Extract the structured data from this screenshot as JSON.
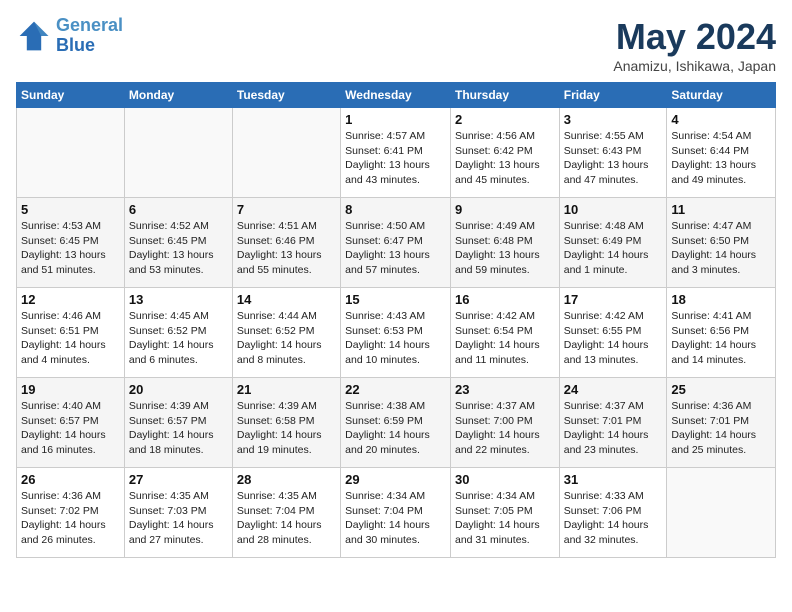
{
  "header": {
    "logo_line1": "General",
    "logo_line2": "Blue",
    "month_title": "May 2024",
    "subtitle": "Anamizu, Ishikawa, Japan"
  },
  "weekdays": [
    "Sunday",
    "Monday",
    "Tuesday",
    "Wednesday",
    "Thursday",
    "Friday",
    "Saturday"
  ],
  "weeks": [
    [
      {
        "day": "",
        "info": ""
      },
      {
        "day": "",
        "info": ""
      },
      {
        "day": "",
        "info": ""
      },
      {
        "day": "1",
        "info": "Sunrise: 4:57 AM\nSunset: 6:41 PM\nDaylight: 13 hours\nand 43 minutes."
      },
      {
        "day": "2",
        "info": "Sunrise: 4:56 AM\nSunset: 6:42 PM\nDaylight: 13 hours\nand 45 minutes."
      },
      {
        "day": "3",
        "info": "Sunrise: 4:55 AM\nSunset: 6:43 PM\nDaylight: 13 hours\nand 47 minutes."
      },
      {
        "day": "4",
        "info": "Sunrise: 4:54 AM\nSunset: 6:44 PM\nDaylight: 13 hours\nand 49 minutes."
      }
    ],
    [
      {
        "day": "5",
        "info": "Sunrise: 4:53 AM\nSunset: 6:45 PM\nDaylight: 13 hours\nand 51 minutes."
      },
      {
        "day": "6",
        "info": "Sunrise: 4:52 AM\nSunset: 6:45 PM\nDaylight: 13 hours\nand 53 minutes."
      },
      {
        "day": "7",
        "info": "Sunrise: 4:51 AM\nSunset: 6:46 PM\nDaylight: 13 hours\nand 55 minutes."
      },
      {
        "day": "8",
        "info": "Sunrise: 4:50 AM\nSunset: 6:47 PM\nDaylight: 13 hours\nand 57 minutes."
      },
      {
        "day": "9",
        "info": "Sunrise: 4:49 AM\nSunset: 6:48 PM\nDaylight: 13 hours\nand 59 minutes."
      },
      {
        "day": "10",
        "info": "Sunrise: 4:48 AM\nSunset: 6:49 PM\nDaylight: 14 hours\nand 1 minute."
      },
      {
        "day": "11",
        "info": "Sunrise: 4:47 AM\nSunset: 6:50 PM\nDaylight: 14 hours\nand 3 minutes."
      }
    ],
    [
      {
        "day": "12",
        "info": "Sunrise: 4:46 AM\nSunset: 6:51 PM\nDaylight: 14 hours\nand 4 minutes."
      },
      {
        "day": "13",
        "info": "Sunrise: 4:45 AM\nSunset: 6:52 PM\nDaylight: 14 hours\nand 6 minutes."
      },
      {
        "day": "14",
        "info": "Sunrise: 4:44 AM\nSunset: 6:52 PM\nDaylight: 14 hours\nand 8 minutes."
      },
      {
        "day": "15",
        "info": "Sunrise: 4:43 AM\nSunset: 6:53 PM\nDaylight: 14 hours\nand 10 minutes."
      },
      {
        "day": "16",
        "info": "Sunrise: 4:42 AM\nSunset: 6:54 PM\nDaylight: 14 hours\nand 11 minutes."
      },
      {
        "day": "17",
        "info": "Sunrise: 4:42 AM\nSunset: 6:55 PM\nDaylight: 14 hours\nand 13 minutes."
      },
      {
        "day": "18",
        "info": "Sunrise: 4:41 AM\nSunset: 6:56 PM\nDaylight: 14 hours\nand 14 minutes."
      }
    ],
    [
      {
        "day": "19",
        "info": "Sunrise: 4:40 AM\nSunset: 6:57 PM\nDaylight: 14 hours\nand 16 minutes."
      },
      {
        "day": "20",
        "info": "Sunrise: 4:39 AM\nSunset: 6:57 PM\nDaylight: 14 hours\nand 18 minutes."
      },
      {
        "day": "21",
        "info": "Sunrise: 4:39 AM\nSunset: 6:58 PM\nDaylight: 14 hours\nand 19 minutes."
      },
      {
        "day": "22",
        "info": "Sunrise: 4:38 AM\nSunset: 6:59 PM\nDaylight: 14 hours\nand 20 minutes."
      },
      {
        "day": "23",
        "info": "Sunrise: 4:37 AM\nSunset: 7:00 PM\nDaylight: 14 hours\nand 22 minutes."
      },
      {
        "day": "24",
        "info": "Sunrise: 4:37 AM\nSunset: 7:01 PM\nDaylight: 14 hours\nand 23 minutes."
      },
      {
        "day": "25",
        "info": "Sunrise: 4:36 AM\nSunset: 7:01 PM\nDaylight: 14 hours\nand 25 minutes."
      }
    ],
    [
      {
        "day": "26",
        "info": "Sunrise: 4:36 AM\nSunset: 7:02 PM\nDaylight: 14 hours\nand 26 minutes."
      },
      {
        "day": "27",
        "info": "Sunrise: 4:35 AM\nSunset: 7:03 PM\nDaylight: 14 hours\nand 27 minutes."
      },
      {
        "day": "28",
        "info": "Sunrise: 4:35 AM\nSunset: 7:04 PM\nDaylight: 14 hours\nand 28 minutes."
      },
      {
        "day": "29",
        "info": "Sunrise: 4:34 AM\nSunset: 7:04 PM\nDaylight: 14 hours\nand 30 minutes."
      },
      {
        "day": "30",
        "info": "Sunrise: 4:34 AM\nSunset: 7:05 PM\nDaylight: 14 hours\nand 31 minutes."
      },
      {
        "day": "31",
        "info": "Sunrise: 4:33 AM\nSunset: 7:06 PM\nDaylight: 14 hours\nand 32 minutes."
      },
      {
        "day": "",
        "info": ""
      }
    ]
  ]
}
